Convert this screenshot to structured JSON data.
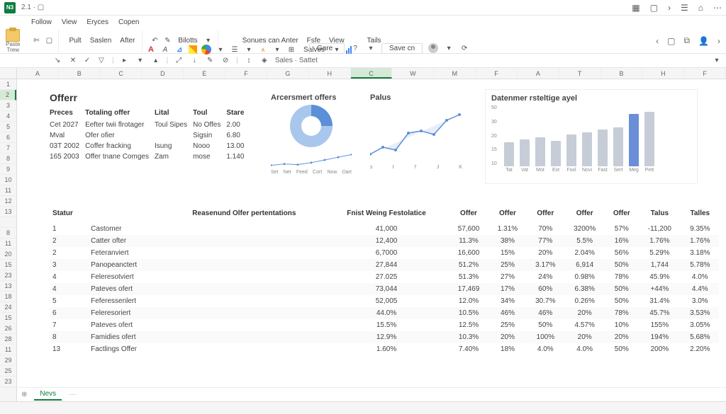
{
  "title_bar": {
    "app": "N3",
    "suffix": "2.1 · ▢"
  },
  "menu": [
    "Follow",
    "View",
    "Eryces",
    "Copen"
  ],
  "ribbon": {
    "paste_label": "Paste",
    "paste_sub": "Trew",
    "group1": [
      "Pult",
      "Saslen",
      "After"
    ],
    "dropdown": "Bilotts",
    "group2": "Sonues can Anter",
    "tabs": [
      "Fsfe",
      "View",
      "Tails"
    ],
    "sales_btn": "Salves",
    "center_input1": "Gare",
    "center_input2": "Save cn"
  },
  "formula_bar": {
    "name_box": "",
    "text": "Sales · Sattet"
  },
  "columns": [
    "A",
    "B",
    "C",
    "D",
    "E",
    "F",
    "G",
    "H",
    "C",
    "W",
    "M",
    "F",
    "A",
    "T",
    "B",
    "H",
    "F"
  ],
  "columns_mid": [
    "F",
    "C"
  ],
  "row_set1": [
    1,
    2,
    3,
    4,
    5,
    6,
    7,
    8,
    9,
    10,
    11,
    12,
    13,
    ""
  ],
  "row_set2": [
    1,
    3,
    5,
    6,
    7,
    9,
    11,
    8,
    13,
    10,
    ""
  ],
  "row_set3": [
    8,
    11,
    20,
    15,
    23,
    13,
    18,
    24,
    15,
    26,
    28,
    11,
    29,
    25,
    23
  ],
  "offerr": {
    "title": "Offerr",
    "headers": [
      "Preces",
      "Totaling offer",
      "Lital",
      "Toul",
      "Stare"
    ],
    "rows": [
      [
        "Cet 2027",
        "Eefter twii flrotager",
        "Toul Sipes",
        "No Offes",
        "2.00"
      ],
      [
        "Mval",
        "Ofer ofier",
        "",
        "Sigsin",
        "6.80"
      ],
      [
        "03T 2002",
        "Coffer fracking",
        "Isung",
        "Nooo",
        "13.00"
      ],
      [
        "165 2003",
        "Offer tnane Comges",
        "Zam",
        "mose",
        "1.140"
      ]
    ]
  },
  "chart_data": [
    {
      "type": "pie",
      "title": "Arcersmert offers",
      "series": [
        {
          "name": "A",
          "value": 25
        },
        {
          "name": "B",
          "value": 75
        }
      ],
      "spark_x": [
        "Set",
        "Net",
        "Feed",
        "Cort",
        "Now",
        "Dart"
      ]
    },
    {
      "type": "line",
      "title": "Palus",
      "x": [
        "s",
        "t",
        "7",
        "J",
        "K"
      ],
      "values": [
        20,
        28,
        24,
        45,
        48,
        42,
        62,
        70
      ],
      "ylim": [
        0,
        80
      ]
    },
    {
      "type": "bar",
      "title": "Datenmer rsteltige ayel",
      "categories": [
        "Tat",
        "Vat",
        "Mot",
        "Ext",
        "Foxl",
        "Novi",
        "Fast",
        "Sert",
        "Meg",
        "Pett"
      ],
      "values": [
        20,
        22,
        24,
        21,
        26,
        28,
        30,
        32,
        43,
        45
      ],
      "highlight_index": 8,
      "ylim": [
        0,
        50
      ],
      "yticks": [
        50,
        30,
        20,
        15,
        10
      ]
    }
  ],
  "data_table": {
    "headers": [
      "Statur",
      "",
      "Reasenund Olfer pertentations",
      "Fnist Weing Festolatice",
      "Offer",
      "Offer",
      "Offer",
      "Offer",
      "Offer",
      "Talus",
      "Talles"
    ],
    "rows": [
      [
        "1",
        "Castomer",
        "",
        "41,000",
        "57,600",
        "1.31%",
        "70%",
        "3200%",
        "57%",
        "-11,200",
        "9.35%"
      ],
      [
        "2",
        "Catter ofter",
        "",
        "12,400",
        "11.3%",
        "38%",
        "77%",
        "5.5%",
        "16%",
        "1.76%",
        "1.76%"
      ],
      [
        "2",
        "Feteranviert",
        "",
        "6,7000",
        "16,600",
        "15%",
        "20%",
        "2.04%",
        "56%",
        "5.29%",
        "3.18%"
      ],
      [
        "3",
        "Panopeanctert",
        "",
        "27,844",
        "51.2%",
        "25%",
        "3.17%",
        "6,914",
        "50%",
        "1,744",
        "5.78%"
      ],
      [
        "4",
        "Feleresotviert",
        "",
        "27.025",
        "51.3%",
        "27%",
        "24%",
        "0.98%",
        "78%",
        "45.9%",
        "4.0%"
      ],
      [
        "4",
        "Pateves ofert",
        "",
        "73,044",
        "17,469",
        "17%",
        "60%",
        "6.38%",
        "50%",
        "+44%",
        "4.4%"
      ],
      [
        "5",
        "Feferessenlert",
        "",
        "52,005",
        "12.0%",
        "34%",
        "30.7%",
        "0.26%",
        "50%",
        "31.4%",
        "3.0%"
      ],
      [
        "6",
        "Feleresoriert",
        "",
        "44.0%",
        "10.5%",
        "46%",
        "46%",
        "20%",
        "78%",
        "45.7%",
        "3.53%"
      ],
      [
        "7",
        "Pateves ofert",
        "",
        "15.5%",
        "12.5%",
        "25%",
        "50%",
        "4.57%",
        "10%",
        "155%",
        "3.05%"
      ],
      [
        "8",
        "Famidies ofert",
        "",
        "12.9%",
        "10.3%",
        "20%",
        "100%",
        "20%",
        "20%",
        "194%",
        "5.68%"
      ],
      [
        "13",
        "Factlings Offer",
        "",
        "1.60%",
        "7.40%",
        "18%",
        "4.0%",
        "4.0%",
        "50%",
        "200%",
        "2.20%"
      ]
    ]
  },
  "sheet_tab": "Nevs"
}
